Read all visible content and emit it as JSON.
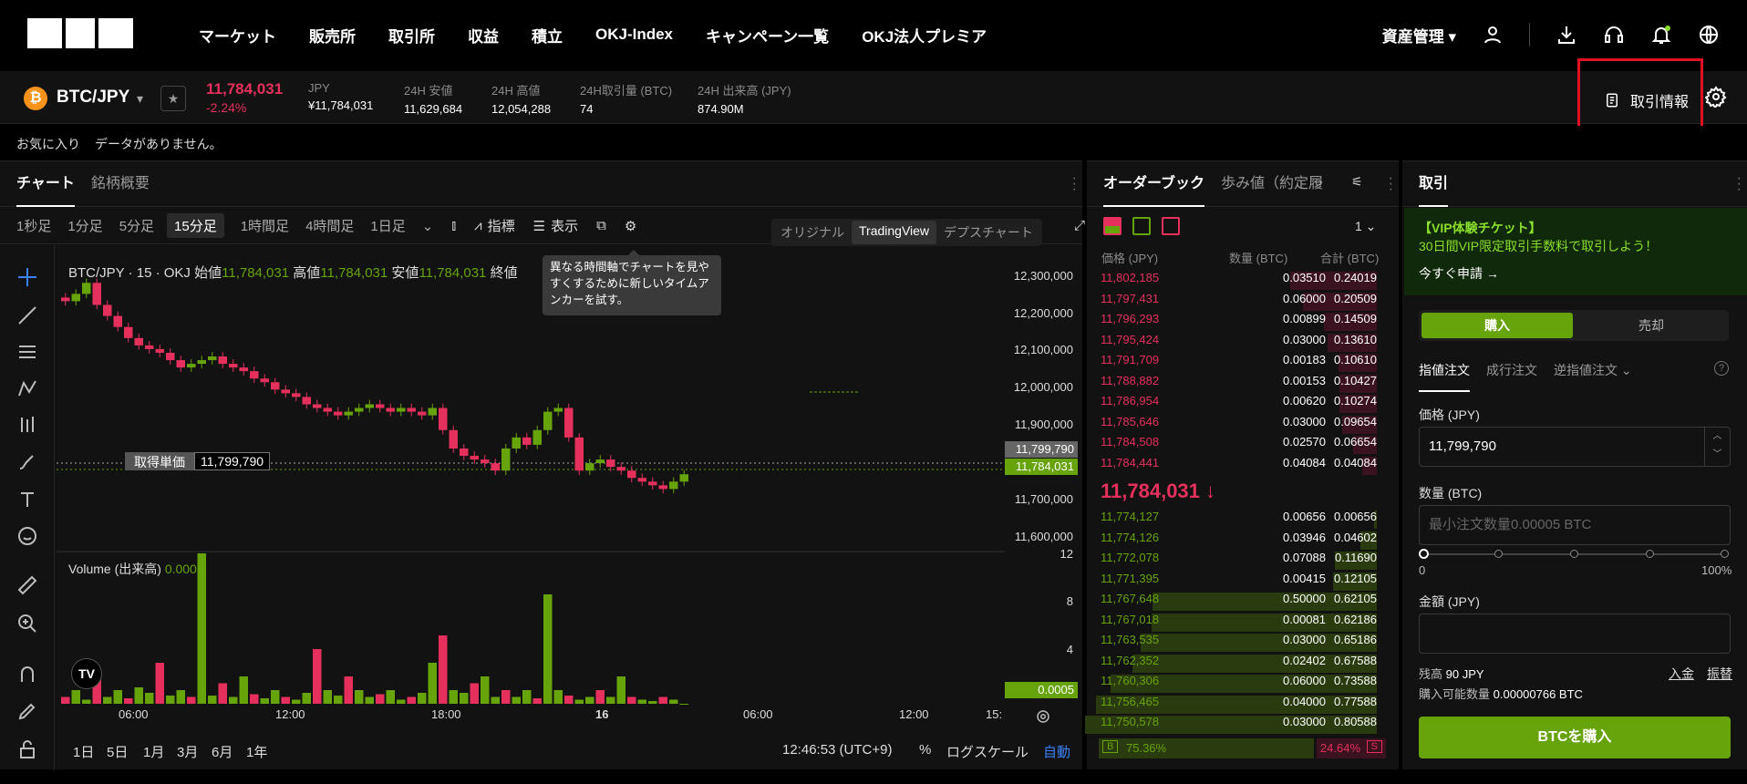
{
  "nav": {
    "menu": [
      "マーケット",
      "販売所",
      "取引所",
      "収益",
      "積立",
      "OKJ-Index",
      "キャンペーン一覧",
      "OKJ法人プレミア"
    ],
    "asset_label": "資産管理",
    "icons": [
      "user-icon",
      "download-icon",
      "headset-icon",
      "bell-icon",
      "globe-icon"
    ]
  },
  "ticker": {
    "coin_symbol": "₿",
    "pair": "BTC/JPY",
    "last_price": "11,784,031",
    "change": "-2.24%",
    "stats": [
      {
        "label": "JPY",
        "value": "¥11,784,031"
      },
      {
        "label": "24H 安値",
        "value": "11,629,684"
      },
      {
        "label": "24H 高値",
        "value": "12,054,288"
      },
      {
        "label": "24H取引量 (BTC)",
        "value": "74"
      },
      {
        "label": "24H 出来高 (JPY)",
        "value": "874.90M"
      }
    ],
    "trade_info": "取引情報"
  },
  "favorites": {
    "label": "お気に入り",
    "empty": "データがありません。"
  },
  "chart": {
    "tabs": [
      "チャート",
      "銘柄概要"
    ],
    "timeframes": [
      "1秒足",
      "1分足",
      "5分足",
      "15分足",
      "1時間足",
      "4時間足",
      "1日足"
    ],
    "selected_tf": "15分足",
    "tools": {
      "indicator": "指標",
      "display": "表示"
    },
    "views": [
      "オリジナル",
      "TradingView",
      "デプスチャート"
    ],
    "active_view": "TradingView",
    "tooltip": "異なる時間軸でチャートを見やすくするために新しいタイムアンカーを試す。",
    "legend_symbol": "BTC/JPY · 15 · OKJ",
    "legend": [
      {
        "label": "始値",
        "value": "11,784,031"
      },
      {
        "label": "高値",
        "value": "11,784,031"
      },
      {
        "label": "安値",
        "value": "11,784,031"
      },
      {
        "label": "終値",
        "value": ""
      }
    ],
    "volume_label": "Volume (出来高)",
    "volume_value": "0.0005",
    "entry_label": "取得単価",
    "entry_value": "11,799,790",
    "price_ticks": [
      "12,300,000",
      "12,200,000",
      "12,100,000",
      "12,000,000",
      "11,900,000",
      "11,700,000",
      "11,600,000"
    ],
    "price_tag_entry": "11,799,790",
    "price_tag_last": "11,784,031",
    "volume_ticks": [
      "12",
      "8",
      "4"
    ],
    "volume_tag": "0.0005",
    "time_ticks": [
      "06:00",
      "12:00",
      "18:00",
      "16",
      "06:00",
      "12:00",
      "15:"
    ],
    "ranges": [
      "1日",
      "5日",
      "1月",
      "3月",
      "6月",
      "1年"
    ],
    "clock": "12:46:53 (UTC+9)",
    "percent": "%",
    "log_scale": "ログスケール",
    "auto": "自動"
  },
  "chart_data": {
    "type": "candlestick",
    "symbol": "BTC/JPY",
    "interval": "15",
    "ylim": [
      11550000,
      12330000
    ],
    "approx_close_path": [
      12220000,
      12240000,
      12270000,
      12210000,
      12180000,
      12150000,
      12120000,
      12100000,
      12090000,
      12080000,
      12060000,
      12040000,
      12050000,
      12060000,
      12070000,
      12050000,
      12040000,
      12030000,
      12010000,
      12000000,
      11980000,
      11970000,
      11960000,
      11940000,
      11930000,
      11920000,
      11910000,
      11920000,
      11930000,
      11940000,
      11930000,
      11920000,
      11930000,
      11920000,
      11910000,
      11930000,
      11870000,
      11820000,
      11800000,
      11790000,
      11780000,
      11760000,
      11820000,
      11850000,
      11830000,
      11870000,
      11920000,
      11930000,
      11850000,
      11760000,
      11780000,
      11790000,
      11770000,
      11760000,
      11740000,
      11730000,
      11720000,
      11710000,
      11730000,
      11750000
    ],
    "volume_approx": [
      0.5,
      1,
      0.3,
      2,
      0.5,
      1,
      0.4,
      1.2,
      0.8,
      3,
      0.6,
      1,
      0.5,
      11,
      0.6,
      1.5,
      0.5,
      2,
      0.7,
      0.4,
      1,
      0.5,
      0.3,
      0.8,
      4,
      1,
      0.6,
      2,
      1,
      0.5,
      0.7,
      1,
      0.3,
      0.5,
      0.8,
      3,
      5,
      1,
      0.8,
      1.5,
      2,
      0.5,
      1,
      0.5,
      1,
      0.4,
      8,
      1,
      0.6,
      0.3,
      0.5,
      1,
      0.5,
      2,
      0.5,
      0.3,
      0.2,
      0.5,
      0.3,
      0.0005
    ]
  },
  "orderbook": {
    "tabs": [
      "オーダーブック",
      "歩み値（約定履"
    ],
    "precision": "1",
    "headers": [
      "価格 (JPY)",
      "数量 (BTC)",
      "合計 (BTC)"
    ],
    "asks": [
      {
        "p": "11,802,185",
        "q": "0.03510",
        "t": "0.24019",
        "d": 0.297
      },
      {
        "p": "11,797,431",
        "q": "0.06000",
        "t": "0.20509",
        "d": 0.254
      },
      {
        "p": "11,796,293",
        "q": "0.00899",
        "t": "0.14509",
        "d": 0.18
      },
      {
        "p": "11,795,424",
        "q": "0.03000",
        "t": "0.13610",
        "d": 0.169
      },
      {
        "p": "11,791,709",
        "q": "0.00183",
        "t": "0.10610",
        "d": 0.131
      },
      {
        "p": "11,788,882",
        "q": "0.00153",
        "t": "0.10427",
        "d": 0.129
      },
      {
        "p": "11,786,954",
        "q": "0.00620",
        "t": "0.10274",
        "d": 0.127
      },
      {
        "p": "11,785,646",
        "q": "0.03000",
        "t": "0.09654",
        "d": 0.12
      },
      {
        "p": "11,784,508",
        "q": "0.02570",
        "t": "0.06654",
        "d": 0.082
      },
      {
        "p": "11,784,441",
        "q": "0.04084",
        "t": "0.04084",
        "d": 0.051
      }
    ],
    "mid_price": "11,784,031 ↓",
    "bids": [
      {
        "p": "11,774,127",
        "q": "0.00656",
        "t": "0.00656",
        "d": 0.008
      },
      {
        "p": "11,774,126",
        "q": "0.03946",
        "t": "0.04602",
        "d": 0.057
      },
      {
        "p": "11,772,078",
        "q": "0.07088",
        "t": "0.11690",
        "d": 0.145
      },
      {
        "p": "11,771,395",
        "q": "0.00415",
        "t": "0.12105",
        "d": 0.15
      },
      {
        "p": "11,767,648",
        "q": "0.50000",
        "t": "0.62105",
        "d": 0.77
      },
      {
        "p": "11,767,018",
        "q": "0.00081",
        "t": "0.62186",
        "d": 0.771
      },
      {
        "p": "11,763,535",
        "q": "0.03000",
        "t": "0.65186",
        "d": 0.808
      },
      {
        "p": "11,762,352",
        "q": "0.02402",
        "t": "0.67588",
        "d": 0.838
      },
      {
        "p": "11,760,306",
        "q": "0.06000",
        "t": "0.73588",
        "d": 0.912
      },
      {
        "p": "11,756,465",
        "q": "0.04000",
        "t": "0.77588",
        "d": 0.962
      },
      {
        "p": "11,750,578",
        "q": "0.03000",
        "t": "0.80588",
        "d": 1.0
      }
    ],
    "buy_ratio": "75.36%",
    "sell_ratio": "24.64%",
    "b": "B",
    "s": "S"
  },
  "order": {
    "tab": "取引",
    "vip_title": "【VIP体験チケット】",
    "vip_desc": "30日間VIP限定取引手数料で取引しよう！",
    "vip_link": "今すぐ申請 →",
    "buy": "購入",
    "sell": "売却",
    "types": [
      "指値注文",
      "成行注文",
      "逆指値注文"
    ],
    "price_label": "価格 (JPY)",
    "price_value": "11,799,790",
    "qty_label": "数量 (BTC)",
    "qty_placeholder": "最小注文数量0.00005 BTC",
    "pct_min": "0",
    "pct_max": "100%",
    "amount_label": "金額 (JPY)",
    "balance_label": "残高",
    "balance_value": "90 JPY",
    "deposit": "入金",
    "transfer": "振替",
    "avail_label": "購入可能数量",
    "avail_value": "0.00000766 BTC",
    "submit": "BTCを購入"
  },
  "colors": {
    "up": "#67a30a",
    "down": "#e5305e",
    "accent": "#67a30a",
    "highlight": "#e01020"
  }
}
